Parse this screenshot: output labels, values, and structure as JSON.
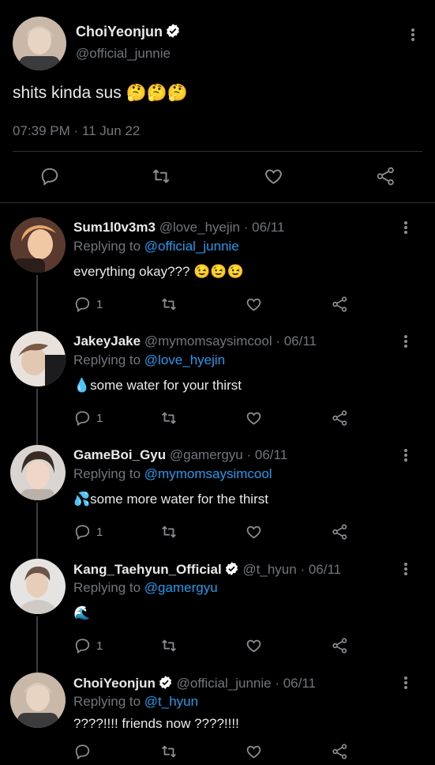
{
  "main_tweet": {
    "name": "ChoiYeonjun",
    "handle": "@official_junnie",
    "text": "shits kinda sus 🤔🤔🤔",
    "time": "07:39 PM · 11 Jun 22"
  },
  "replies": [
    {
      "name": "Sum1l0v3m3",
      "handle": "@love_hyejin",
      "date": "· 06/11",
      "replying_label": "Replying to",
      "replying_to": "@official_junnie",
      "text": "everything okay??? 😉😉😉",
      "reply_count": "1",
      "verified": false
    },
    {
      "name": "JakeyJake",
      "handle": "@mymomsaysimcool",
      "date": "· 06/11",
      "replying_label": "Replying to",
      "replying_to": "@love_hyejin",
      "text": "💧some water for your thirst",
      "reply_count": "1",
      "verified": false
    },
    {
      "name": "GameBoi_Gyu",
      "handle": "@gamergyu",
      "date": "· 06/11",
      "replying_label": "Replying to",
      "replying_to": "@mymomsaysimcool",
      "text": "💦some more water for the thirst",
      "reply_count": "1",
      "verified": false
    },
    {
      "name": "Kang_Taehyun_Official",
      "handle": "@t_hyun",
      "date": "· 06/11",
      "replying_label": "Replying to",
      "replying_to": "@gamergyu",
      "text": "🌊",
      "reply_count": "1",
      "verified": true
    },
    {
      "name": "ChoiYeonjun",
      "handle": "@official_junnie",
      "date": "· 06/11",
      "replying_label": "Replying to",
      "replying_to": "@t_hyun",
      "text": "????!!!! friends now ????!!!!",
      "reply_count": "",
      "verified": true
    }
  ],
  "colors": {
    "background": "#000000",
    "link": "#1d9bf0",
    "muted": "#71767b",
    "verified": "#ffffff"
  },
  "icons": [
    "verified-icon",
    "more-icon",
    "reply-icon",
    "retweet-icon",
    "like-icon",
    "share-icon"
  ]
}
